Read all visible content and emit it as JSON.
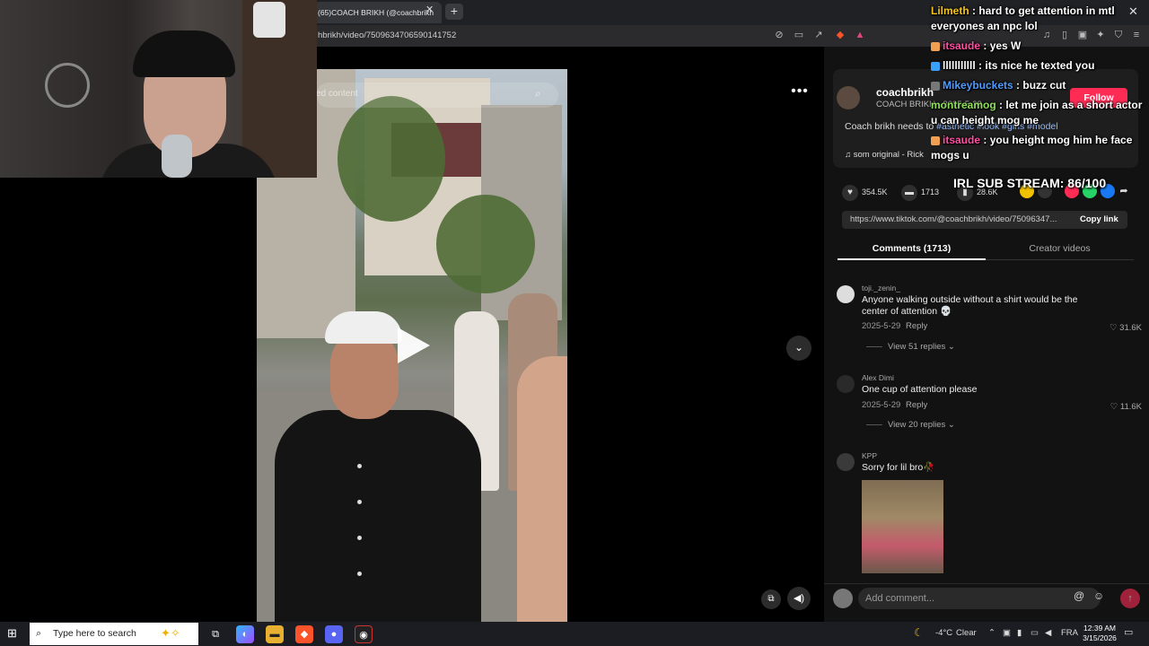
{
  "browser": {
    "tab_title": "(65)COACH BRIKH (@coachbrikh",
    "url": "hbrikh/video/7509634706590141752"
  },
  "video": {
    "search_placeholder": "ed content"
  },
  "post": {
    "author": "coachbrikh",
    "author_sub": "COACH BRIKH · 2025-5-28",
    "follow": "Follow",
    "caption_text": "Coach brikh needs to ",
    "hashtags": [
      "#asthetic",
      "#look",
      "#girls",
      "#model"
    ],
    "music": "som original - Rick",
    "likes": "354.5K",
    "comments_count": "1713",
    "saves": "28.6K",
    "link": "https://www.tiktok.com/@coachbrikh/video/75096347...",
    "copy_link": "Copy link"
  },
  "tabs": {
    "comments": "Comments (1713)",
    "creator": "Creator videos"
  },
  "comments": [
    {
      "user": "toji._zenin_",
      "text": "Anyone walking outside without a shirt would be the center of attention 💀",
      "date": "2025-5-29",
      "reply": "Reply",
      "likes": "31.6K",
      "more": "View 51 replies"
    },
    {
      "user": "Alex Dimi",
      "text": "One cup of attention please",
      "date": "2025-5-29",
      "reply": "Reply",
      "likes": "11.6K",
      "more": "View 20 replies"
    },
    {
      "user": "KPP",
      "text": "Sorry for lil bro🥀"
    }
  ],
  "comment_bar": {
    "placeholder": "Add comment..."
  },
  "chat": [
    {
      "user": "Lilmeth",
      "color": "#f5c518",
      "msg": "hard to get attention in mtl everyones an npc lol"
    },
    {
      "user": "itsaude",
      "color": "#ff4fa3",
      "msg": "yes W"
    },
    {
      "user": "lllllllllll",
      "color": "#ffffff",
      "msg": "its nice he texted you"
    },
    {
      "user": "Mikeybuckets",
      "color": "#4f9bff",
      "msg": "buzz cut"
    },
    {
      "user": "montreamog",
      "color": "#8ee05a",
      "msg": "let me join as a short actor u can height mog me"
    },
    {
      "user": "itsaude",
      "color": "#ff4fa3",
      "msg": "you height mog him he face mogs u"
    }
  ],
  "sub_stream": "IRL SUB STREAM: 86/100",
  "taskbar": {
    "search_placeholder": "Type here to search",
    "temperature": "-4°C",
    "weather": "Clear",
    "language": "FRA",
    "time": "12:39 AM",
    "date": "3/15/2026"
  },
  "colors": {
    "accent": "#fe2c55",
    "hashtag": "#8fb8ff"
  }
}
